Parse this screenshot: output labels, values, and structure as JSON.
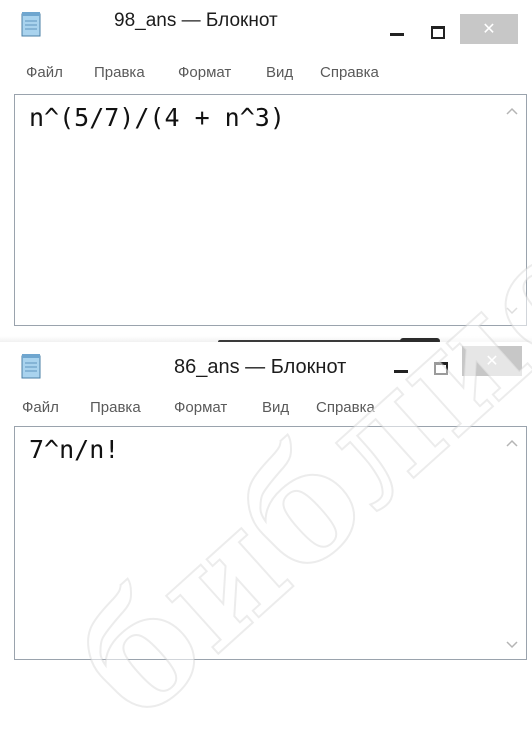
{
  "windows": [
    {
      "title": "98_ans — Блокнот",
      "menu": [
        "Файл",
        "Правка",
        "Формат",
        "Вид",
        "Справка"
      ],
      "content": "n^(5/7)/(4 + n^3)",
      "close_glyph": "✕"
    },
    {
      "title": "86_ans — Блокнот",
      "menu": [
        "Файл",
        "Правка",
        "Формат",
        "Вид",
        "Справка"
      ],
      "content": "7^n/n!",
      "close_glyph": "✕"
    }
  ],
  "watermark": "библиотека",
  "colors": {
    "close_button": "#c7c7c7",
    "editor_border": "#9aa3ad",
    "menu_text": "#5a5a5a"
  },
  "icons": [
    "notepad-icon",
    "minimize-icon",
    "maximize-icon",
    "close-icon",
    "scroll-up-arrow-icon",
    "scroll-down-arrow-icon"
  ]
}
